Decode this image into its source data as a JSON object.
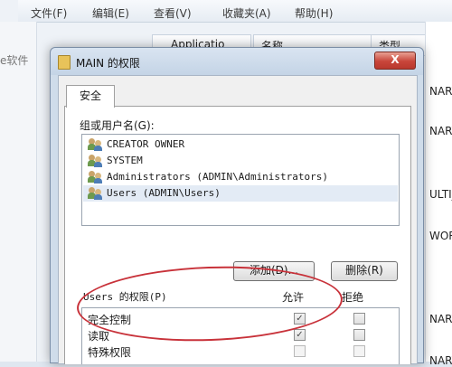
{
  "background": {
    "menu": [
      "文件(F)",
      "编辑(E)",
      "查看(V)",
      "收藏夹(A)",
      "帮助(H)"
    ],
    "nav_header": "Applicatio",
    "name_header": "名称",
    "type_header": "类型",
    "left_partial": "e软件",
    "right_values": [
      "NARY",
      "NARY",
      "ULTI_S",
      "WORD",
      "NARY",
      "NARY"
    ]
  },
  "dialog": {
    "title": "MAIN 的权限",
    "close_label": "X",
    "tab_label": "安全",
    "group_label": "组或用户名(G):",
    "users": [
      "CREATOR OWNER",
      "SYSTEM",
      "Administrators (ADMIN\\Administrators)",
      "Users (ADMIN\\Users)"
    ],
    "selected_user_index": 3,
    "add_button": "添加(D)...",
    "remove_button": "删除(R)",
    "permissions_label": "Users 的权限(P)",
    "allow_header": "允许",
    "deny_header": "拒绝",
    "permissions": [
      {
        "name": "完全控制",
        "allow": true,
        "deny": false
      },
      {
        "name": "读取",
        "allow": true,
        "deny": false
      },
      {
        "name": "特殊权限",
        "allow": false,
        "deny": false
      }
    ]
  },
  "colors": {
    "selection": "#e3ebf5",
    "close_button": "#c8453a",
    "annotation_ellipse": "#c8323a"
  }
}
